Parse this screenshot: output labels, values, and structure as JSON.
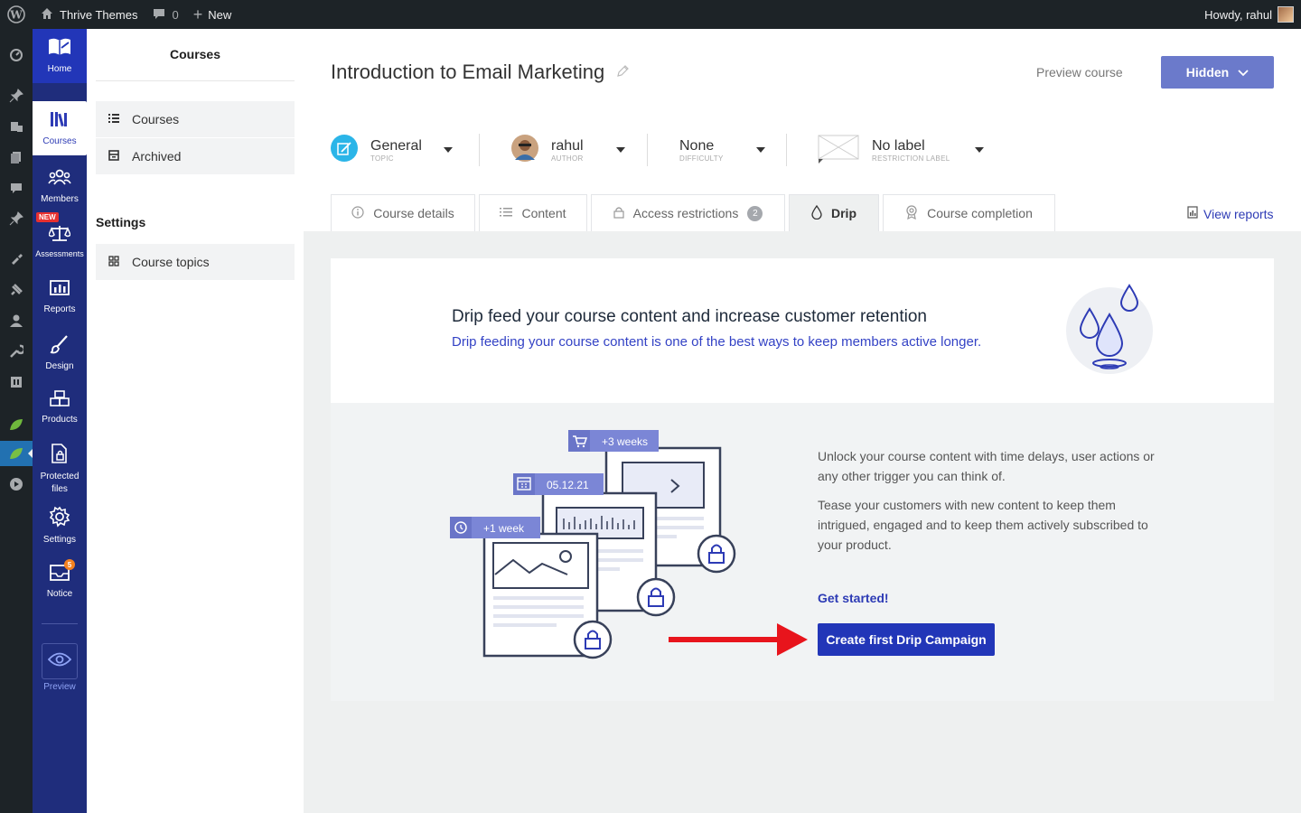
{
  "adminbar": {
    "site_name": "Thrive Themes",
    "comments_count": "0",
    "new_label": "New",
    "greeting": "Howdy, rahul"
  },
  "appnav": {
    "home": "Home",
    "courses": "Courses",
    "members": "Members",
    "assessments": "Assessments",
    "assessments_badge": "NEW",
    "reports": "Reports",
    "design": "Design",
    "products": "Products",
    "protected_files_1": "Protected",
    "protected_files_2": "files",
    "settings": "Settings",
    "notice": "Notice",
    "notice_count": "5",
    "preview": "Preview"
  },
  "subpanel": {
    "header": "Courses",
    "items": [
      {
        "label": "Courses"
      },
      {
        "label": "Archived"
      }
    ],
    "settings_header": "Settings",
    "settings_items": [
      {
        "label": "Course topics"
      }
    ]
  },
  "course": {
    "title": "Introduction to Email Marketing",
    "preview_label": "Preview course",
    "status_label": "Hidden",
    "meta": {
      "topic": {
        "value": "General",
        "label": "TOPIC"
      },
      "author": {
        "value": "rahul",
        "label": "AUTHOR"
      },
      "difficulty": {
        "value": "None",
        "label": "DIFFICULTY"
      },
      "restriction": {
        "value": "No label",
        "label": "RESTRICTION LABEL"
      }
    }
  },
  "tabs": [
    {
      "label": "Course details"
    },
    {
      "label": "Content"
    },
    {
      "label": "Access restrictions",
      "count": "2"
    },
    {
      "label": "Drip"
    },
    {
      "label": "Course completion"
    }
  ],
  "view_reports": "View reports",
  "drip": {
    "heading": "Drip feed your course content and increase customer retention",
    "subheading": "Drip feeding your course content is one of the best ways to keep members active longer.",
    "para1": "Unlock your course content with time delays, user actions or any other trigger you can think of.",
    "para2": "Tease your customers with new content to keep them intrigued, engaged and to keep them actively subscribed to your product.",
    "get_started": "Get started!",
    "cta": "Create first Drip Campaign",
    "illustration_tags": {
      "weeks3": "+3 weeks",
      "date": "05.12.21",
      "week1": "+1 week"
    }
  },
  "colors": {
    "primary": "#2236b8",
    "nav_bg": "#1f2d7c",
    "wp_bar": "#1d2327",
    "arrow": "#e8141c"
  }
}
